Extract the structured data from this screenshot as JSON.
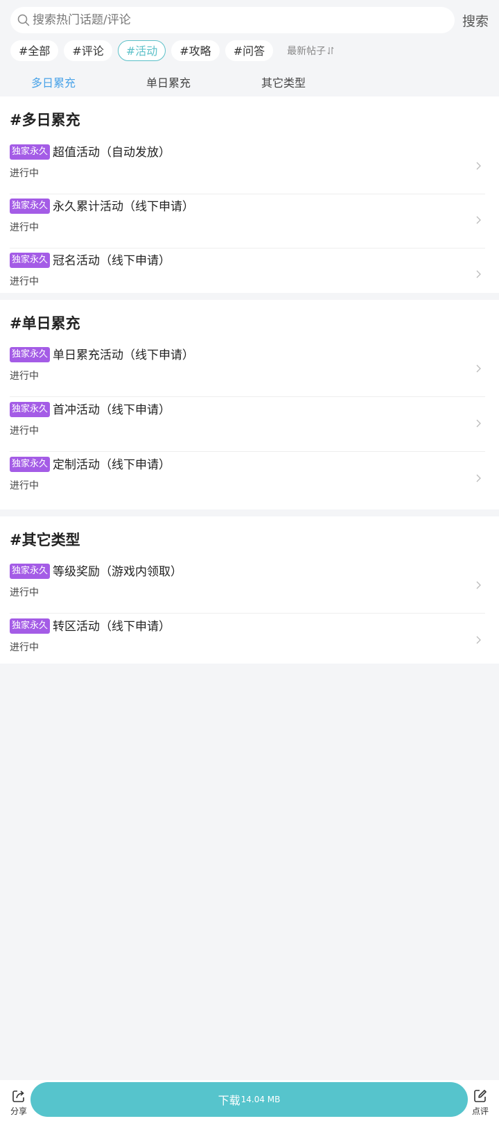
{
  "search": {
    "placeholder": "搜索热门话题/评论",
    "button_label": "搜索"
  },
  "tags": [
    {
      "label": "#全部",
      "active": false
    },
    {
      "label": "#评论",
      "active": false
    },
    {
      "label": "#活动",
      "active": true
    },
    {
      "label": "#攻略",
      "active": false
    },
    {
      "label": "#问答",
      "active": false
    }
  ],
  "sort": {
    "label": "最新帖子",
    "icon": "sort-arrows-icon"
  },
  "category_tabs": [
    {
      "label": "多日累充",
      "active": true
    },
    {
      "label": "单日累充",
      "active": false
    },
    {
      "label": "其它类型",
      "active": false
    }
  ],
  "sections": [
    {
      "title": "#多日累充",
      "items": [
        {
          "badge": "独家永久",
          "title": "超值活动（自动发放）",
          "status": "进行中"
        },
        {
          "badge": "独家永久",
          "title": "永久累计活动（线下申请）",
          "status": "进行中"
        },
        {
          "badge": "独家永久",
          "title": "冠名活动（线下申请）",
          "status": "进行中"
        }
      ]
    },
    {
      "title": "#单日累充",
      "items": [
        {
          "badge": "独家永久",
          "title": "单日累充活动（线下申请）",
          "status": "进行中"
        },
        {
          "badge": "独家永久",
          "title": "首冲活动（线下申请）",
          "status": "进行中"
        },
        {
          "badge": "独家永久",
          "title": "定制活动（线下申请）",
          "status": "进行中"
        }
      ]
    },
    {
      "title": "#其它类型",
      "items": [
        {
          "badge": "独家永久",
          "title": "等级奖励（游戏内领取）",
          "status": "进行中"
        },
        {
          "badge": "独家永久",
          "title": "转区活动（线下申请）",
          "status": "进行中"
        }
      ]
    }
  ],
  "bottom_bar": {
    "share_label": "分享",
    "download_label": "下载",
    "download_size": "14.04 MB",
    "review_label": "点评"
  },
  "colors": {
    "accent": "#56c4cc",
    "tab_active": "#4aa3e8",
    "badge": "#a45ce6",
    "background": "#f4f5f7"
  }
}
